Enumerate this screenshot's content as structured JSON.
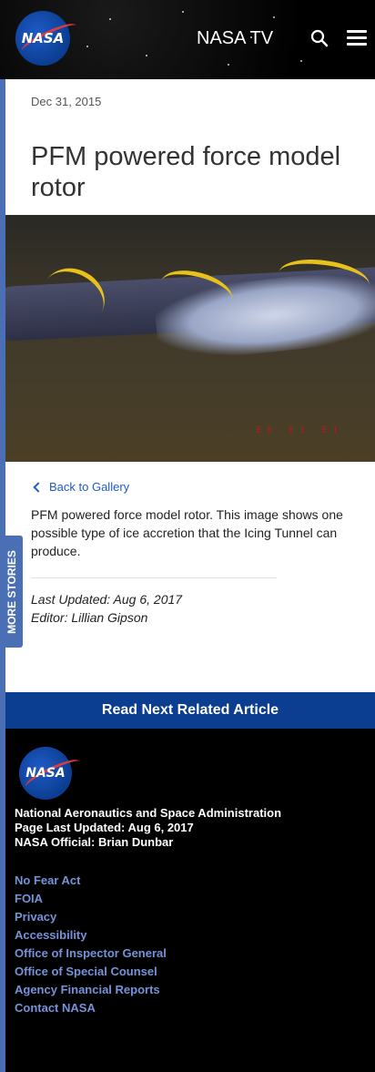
{
  "header": {
    "logo_text": "NASA",
    "nav_title": "NASA TV",
    "search_icon": "search-icon",
    "menu_icon": "hamburger-menu-icon"
  },
  "article": {
    "date": "Dec 31, 2015",
    "title": "PFM powered force model rotor",
    "back_link": "Back to Gallery",
    "description": "PFM powered force model rotor. This image shows one possible type of ice accretion that the Icing Tunnel can produce.",
    "last_updated": "Last Updated: Aug 6, 2017",
    "editor": "Editor: Lillian Gipson"
  },
  "side_tab": {
    "label": "MORE STORIES"
  },
  "read_next": {
    "label": "Read Next Related Article"
  },
  "footer": {
    "logo_text": "NASA",
    "agency_name": "National Aeronautics and Space Administration",
    "page_updated": "Page Last Updated: Aug 6, 2017",
    "official": "NASA Official: Brian Dunbar",
    "links": [
      "No Fear Act",
      "FOIA",
      "Privacy",
      "Accessibility",
      "Office of Inspector General",
      "Office of Special Counsel",
      "Agency Financial Reports",
      "Contact NASA"
    ]
  },
  "colors": {
    "brand_blue": "#0b3d91",
    "link_blue": "#1f5bc6",
    "side_tab": "#4a6fb5",
    "nasa_red": "#e03a3e"
  }
}
